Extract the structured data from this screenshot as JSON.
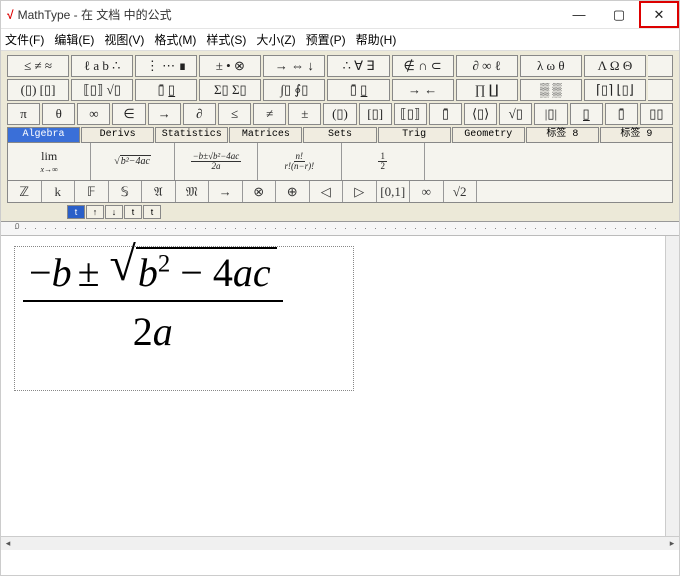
{
  "titlebar": {
    "app": "MathType",
    "suffix": " - 在 文档 中的公式"
  },
  "menus": [
    "文件(F)",
    "编辑(E)",
    "视图(V)",
    "格式(M)",
    "样式(S)",
    "大小(Z)",
    "预置(P)",
    "帮助(H)"
  ],
  "palette_rows": [
    [
      "≤ ≠ ≈",
      "ℓ a b ∴",
      "⋮ ⋯ ∎",
      "± • ⊗",
      "→ ⇔ ↓",
      "∴ ∀ ∃",
      "∉ ∩ ⊂",
      "∂ ∞ ℓ",
      "λ ω θ",
      "Λ Ω Θ"
    ],
    [
      "(▯) [▯]",
      "⟦▯⟧ √▯",
      "▯̄ ▯̲",
      "Σ▯ Σ▯",
      "∫▯ ∮▯",
      "▯̄ ▯̲",
      "→ ←",
      "∏ ∐",
      "▒ ▒",
      "⌈▯⌉ ⌊▯⌋"
    ]
  ],
  "palette_rows_2": [
    "π",
    "θ",
    "∞",
    "∈",
    "→",
    "∂",
    "≤",
    "≠",
    "±",
    "(▯)",
    "[▯]",
    "⟦▯⟧",
    "▯̄",
    "⟨▯⟩",
    "√▯",
    "|▯|",
    "▯̲",
    "▯̄",
    "▯▯"
  ],
  "tabs": [
    "Algebra",
    "Derivs",
    "Statistics",
    "Matrices",
    "Sets",
    "Trig",
    "Geometry",
    "标签 8",
    "标签 9"
  ],
  "templates": [
    {
      "html": "<div style='text-align:center;line-height:1'><span>lim</span><br><span style='font-size:8px;font-style:italic'>x→∞</span></div>"
    },
    {
      "html": "<span class='mini-sqrt'>√<span style='border-top:1px solid #333;padding:0 1px;font-style:italic'>b²−4ac</span></span>"
    },
    {
      "html": "<span class='mini-frac'><span class='n' style='font-style:italic'>−b±√b²−4ac</span><span class='d' style='font-style:italic'>2a</span></span>"
    },
    {
      "html": "<span class='mini-frac'><span class='n' style='font-style:italic'>n!</span><span class='d' style='font-style:italic'>r!(n−r)!</span></span>"
    },
    {
      "html": "<span class='mini-frac'><span class='n'>1</span><span class='d'>2</span></span>"
    },
    {
      "html": ""
    }
  ],
  "syms": [
    "ℤ",
    "k",
    "𝔽",
    "𝕊",
    "𝔄",
    "𝔐",
    "→",
    "⊗",
    "⊕",
    "◁",
    "▷",
    "[0,1]",
    "∞",
    "√2",
    ""
  ],
  "tinybuttons": [
    "t",
    "↑",
    "↓",
    "t",
    "t"
  ],
  "formula": {
    "minus": "−",
    "b1": "b",
    "pm": "±",
    "b2": "b",
    "exp": "2",
    "minus2": " − 4",
    "ac": "ac",
    "den": "2a"
  }
}
